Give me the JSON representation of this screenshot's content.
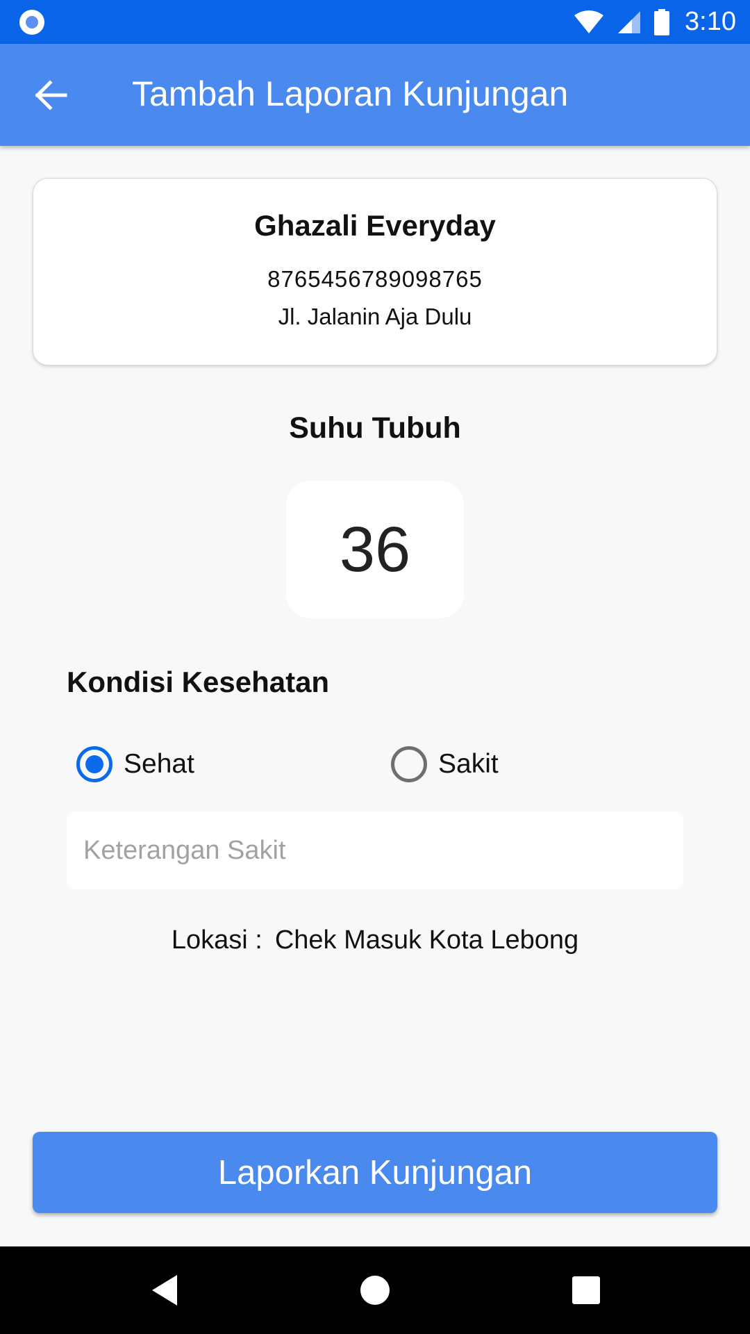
{
  "status_bar": {
    "time": "3:10",
    "icons": [
      "notification-dot-icon",
      "wifi-icon",
      "signal-icon",
      "battery-icon"
    ]
  },
  "app_bar": {
    "title": "Tambah Laporan Kunjungan",
    "back_icon": "arrow-back-icon"
  },
  "info_card": {
    "name": "Ghazali Everyday",
    "number": "8765456789098765",
    "address": "Jl. Jalanin Aja Dulu"
  },
  "temperature": {
    "label": "Suhu Tubuh",
    "value": "36"
  },
  "health": {
    "label": "Kondisi Kesehatan",
    "options": [
      {
        "label": "Sehat",
        "selected": true
      },
      {
        "label": "Sakit",
        "selected": false
      }
    ],
    "notes_value": "",
    "notes_placeholder": "Keterangan Sakit"
  },
  "location": {
    "label": "Lokasi :",
    "value": "Chek Masuk Kota Lebong"
  },
  "submit": {
    "label": "Laporkan Kunjungan"
  },
  "nav_bar": {
    "icons": [
      "nav-back-icon",
      "nav-home-icon",
      "nav-recents-icon"
    ]
  },
  "colors": {
    "status_bar": "#0a64e8",
    "app_bar": "#4a8aef",
    "radio_selected": "#0a6ae9",
    "background": "#f8f8f8"
  }
}
